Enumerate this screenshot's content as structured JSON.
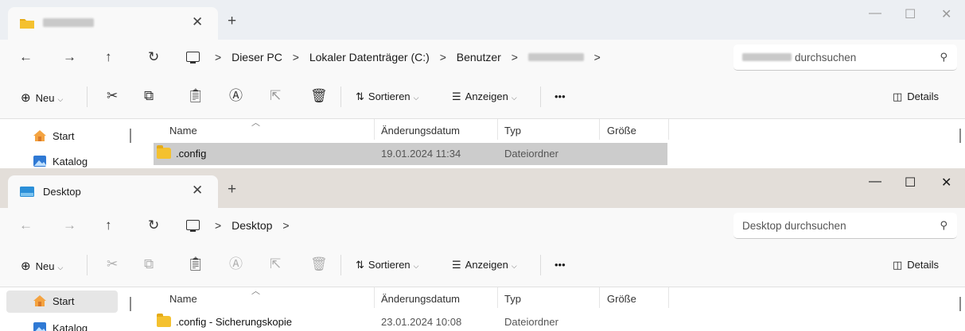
{
  "window1": {
    "tab": {
      "title": "",
      "close": "✕"
    },
    "new_tab": "+",
    "controls": {
      "minimize": "—",
      "maximize": "☐",
      "close": "✕"
    },
    "nav": {
      "back": "←",
      "forward": "→",
      "up": "↑",
      "refresh": "↻"
    },
    "breadcrumb": [
      "Dieser PC",
      "Lokaler Datenträger (C:)",
      "Benutzer"
    ],
    "breadcrumb_sep": ">",
    "search_placeholder": "durchsuchen",
    "search_icon": "⚲",
    "toolbar": {
      "new": "Neu",
      "sort": "Sortieren",
      "view": "Anzeigen",
      "more": "•••",
      "details": "Details"
    },
    "sidebar": [
      "Start",
      "Katalog"
    ],
    "columns": [
      "Name",
      "Änderungsdatum",
      "Typ",
      "Größe"
    ],
    "rows": [
      {
        "name": ".config",
        "date": "19.01.2024 11:34",
        "type": "Dateiordner",
        "size": ""
      }
    ]
  },
  "window2": {
    "tab": {
      "title": "Desktop",
      "close": "✕"
    },
    "new_tab": "+",
    "controls": {
      "minimize": "—",
      "maximize": "☐",
      "close": "✕"
    },
    "nav": {
      "back": "←",
      "forward": "→",
      "up": "↑",
      "refresh": "↻"
    },
    "breadcrumb": [
      "Desktop"
    ],
    "breadcrumb_sep": ">",
    "search_placeholder": "Desktop durchsuchen",
    "search_icon": "⚲",
    "toolbar": {
      "new": "Neu",
      "sort": "Sortieren",
      "view": "Anzeigen",
      "more": "•••",
      "details": "Details"
    },
    "sidebar": [
      "Start",
      "Katalog"
    ],
    "columns": [
      "Name",
      "Änderungsdatum",
      "Typ",
      "Größe"
    ],
    "rows": [
      {
        "name": ".config - Sicherungskopie",
        "date": "23.01.2024 10:08",
        "type": "Dateiordner",
        "size": ""
      }
    ]
  },
  "icons": {
    "folder": "folder-icon",
    "drive": "computer-icon",
    "home": "home-icon",
    "gallery": "gallery-icon",
    "cut": "scissors-icon",
    "copy": "copy-icon",
    "paste": "paste-icon",
    "rename": "rename-icon",
    "share": "share-icon",
    "delete": "trash-icon",
    "new": "plus-circle-icon",
    "sort": "sort-icon",
    "view": "view-icon",
    "details": "details-pane-icon"
  },
  "colors": {
    "folder": "#f4c12f",
    "selection": "#cccccc",
    "toolbar_bg": "#f9f9f9",
    "title_bg_1": "#eceff3",
    "title_bg_2": "#e3ded9"
  }
}
